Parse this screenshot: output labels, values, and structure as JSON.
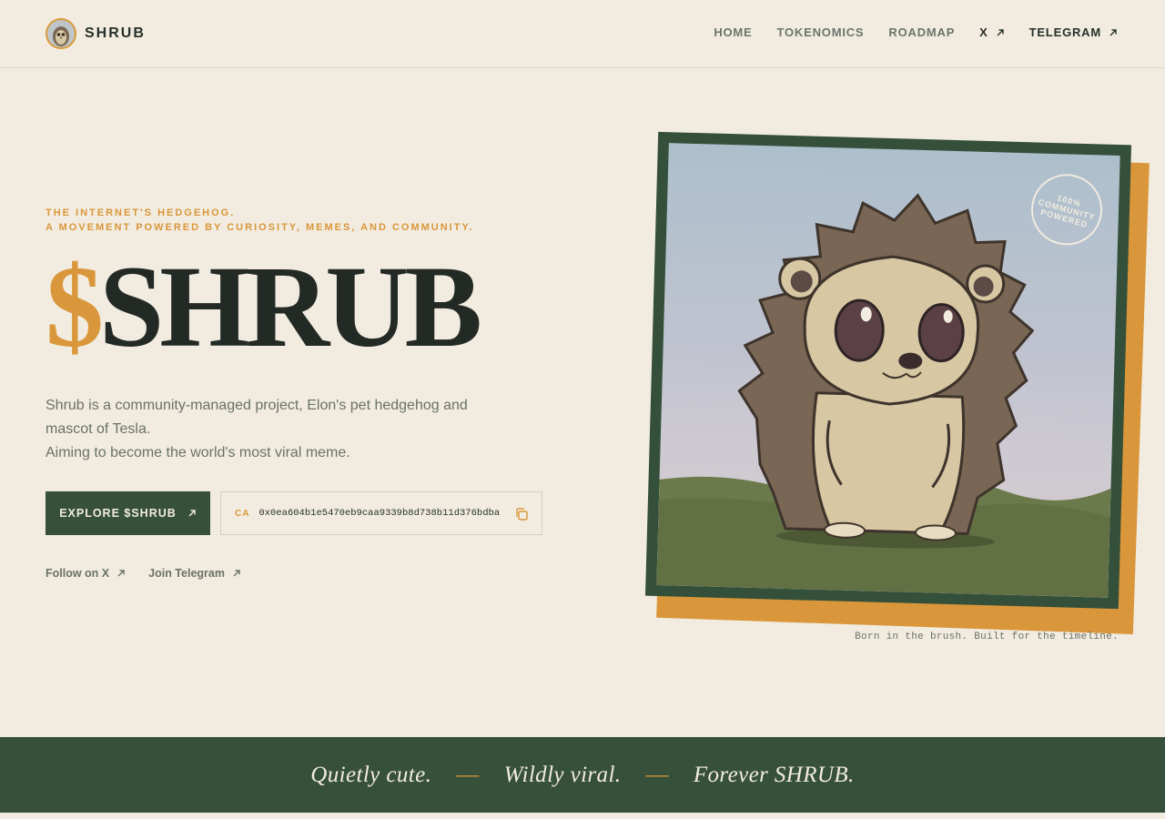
{
  "header": {
    "brand_name": "SHRUB",
    "nav": {
      "home": "HOME",
      "tokenomics": "TOKENOMICS",
      "roadmap": "ROADMAP",
      "x": "X",
      "telegram": "TELEGRAM"
    }
  },
  "hero": {
    "eyebrow_line1": "THE INTERNET'S HEDGEHOG.",
    "eyebrow_line2": "A MOVEMENT POWERED BY CURIOSITY, MEMES, AND COMMUNITY.",
    "title_symbol": "$",
    "title_word": "SHRUB",
    "desc_line1": "Shrub is a community-managed project, Elon's pet hedgehog and mascot of Tesla.",
    "desc_line2": "Aiming to become the world's most viral meme.",
    "cta_label": "EXPLORE $SHRUB",
    "ca_label": "CA",
    "ca_value": "0x0ea604b1e5470eb9caa9339b8d738b11d376bdba",
    "follow_x": "Follow on X",
    "join_telegram": "Join Telegram"
  },
  "image": {
    "stamp_line1": "100%",
    "stamp_line2": "COMMUNITY",
    "stamp_line3": "POWERED",
    "caption": "Born in the brush. Built for the timeline."
  },
  "banner": {
    "phrase1": "Quietly cute.",
    "phrase2": "Wildly viral.",
    "phrase3": "Forever SHRUB.",
    "separator": "—"
  },
  "colors": {
    "background": "#f2ece0",
    "accent": "#d9963a",
    "forest": "#37503a",
    "ink": "#232a25"
  }
}
